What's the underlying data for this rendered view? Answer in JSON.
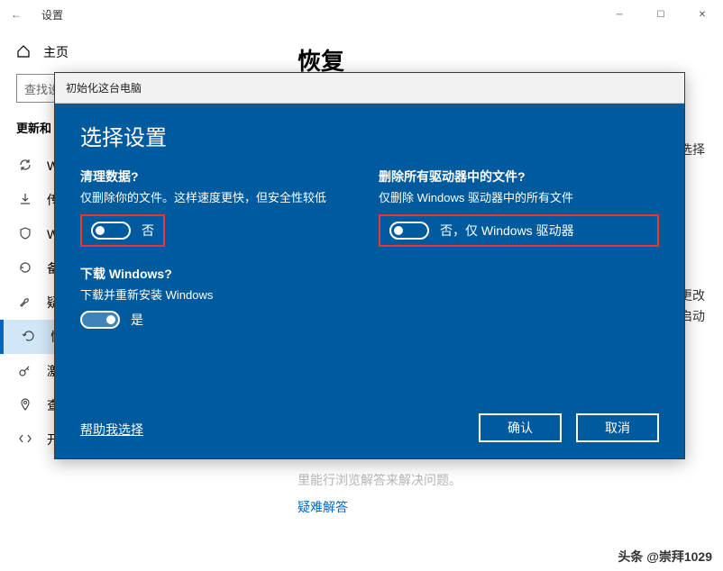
{
  "window": {
    "title": "设置"
  },
  "sidebar": {
    "home": "主页",
    "search_placeholder": "查找设",
    "section": "更新和",
    "items": [
      {
        "label": "W",
        "icon": "sync"
      },
      {
        "label": "传",
        "icon": "download"
      },
      {
        "label": "W",
        "icon": "shield"
      },
      {
        "label": "备",
        "icon": "backup"
      },
      {
        "label": "疑",
        "icon": "wrench"
      },
      {
        "label": "恢",
        "icon": "recover",
        "selected": true
      },
      {
        "label": "激",
        "icon": "key"
      },
      {
        "label": "查找我的设备",
        "icon": "location"
      },
      {
        "label": "开发者选项",
        "icon": "code"
      }
    ]
  },
  "content": {
    "heading": "恢复",
    "right_snip1": "选择",
    "right_snip2a": "更改",
    "right_snip2b": "启动",
    "subhead": "",
    "blur_line": "里能行浏览解答来解决问题。",
    "link": "疑难解答"
  },
  "modal": {
    "title": "初始化这台电脑",
    "heading": "选择设置",
    "opt1": {
      "q": "清理数据?",
      "desc": "仅删除你的文件。这样速度更快，但安全性较低",
      "toggle_label": "否"
    },
    "opt2": {
      "q": "删除所有驱动器中的文件?",
      "desc": "仅删除 Windows 驱动器中的所有文件",
      "toggle_label": "否，仅 Windows 驱动器"
    },
    "opt3": {
      "q": "下载 Windows?",
      "desc": "下载并重新安装 Windows",
      "toggle_label": "是"
    },
    "help": "帮助我选择",
    "confirm": "确认",
    "cancel": "取消"
  },
  "watermark": "头条 @崇拜1029"
}
